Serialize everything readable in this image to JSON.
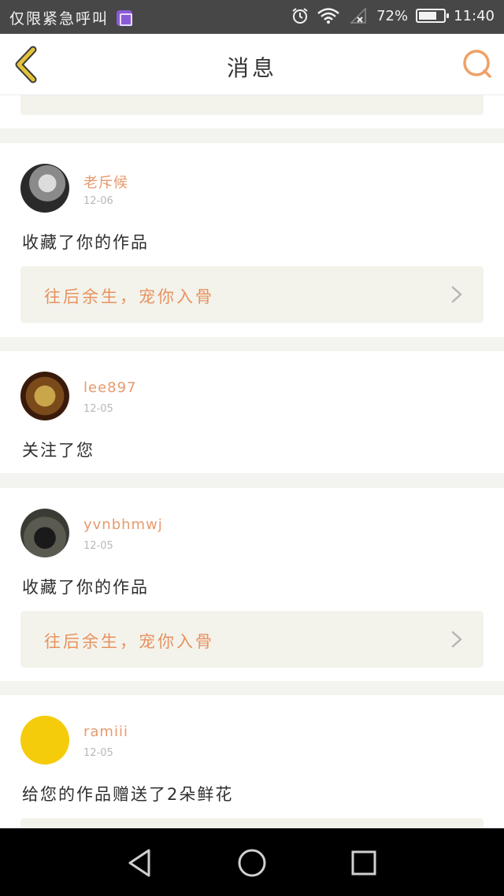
{
  "status_bar": {
    "carrier": "仅限紧急呼叫",
    "battery_percent": "72%",
    "battery_level": 0.72,
    "time": "11:40"
  },
  "header": {
    "title": "消息"
  },
  "messages": [
    {
      "username": "老斥候",
      "date": "12-06",
      "action": "收藏了你的作品",
      "work_title": "往后余生，宠你入骨"
    },
    {
      "username": "lee897",
      "date": "12-05",
      "action": "关注了您"
    },
    {
      "username": "yvnbhmwj",
      "date": "12-05",
      "action": "收藏了你的作品",
      "work_title": "往后余生，宠你入骨"
    },
    {
      "username": "ramiii",
      "date": "12-05",
      "action": "给您的作品赠送了2朵鲜花"
    }
  ],
  "colors": {
    "accent": "#e8925e",
    "username": "#e79a6e",
    "back_icon": "#e2c23a",
    "search_icon": "#f0a066"
  },
  "icons": [
    "back-arrow-icon",
    "search-icon",
    "chevron-right-icon",
    "nav-back-icon",
    "nav-home-icon",
    "nav-recents-icon",
    "alarm-icon",
    "wifi-icon",
    "signal-icon",
    "battery-icon",
    "gallery-icon"
  ]
}
